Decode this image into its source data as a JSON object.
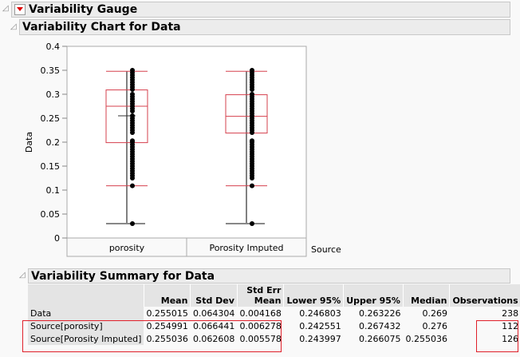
{
  "outline": {
    "gauge_title": "Variability Gauge",
    "chart_title": "Variability Chart for Data",
    "summary_title": "Variability Summary for Data"
  },
  "chart_data": {
    "type": "box",
    "ylabel": "Data",
    "xlabel": "Source",
    "ylim": [
      0,
      0.4
    ],
    "yticks": [
      "0",
      "0.05",
      "0.1",
      "0.15",
      "0.2",
      "0.25",
      "0.3",
      "0.35",
      "0.4"
    ],
    "categories": [
      "porosity",
      "Porosity Imputed"
    ],
    "boxes": [
      {
        "name": "porosity",
        "min": 0.03,
        "q1": 0.199,
        "median": 0.275,
        "q3": 0.309,
        "mean": 0.255,
        "whisker_low": 0.109,
        "whisker_high": 0.348
      },
      {
        "name": "Porosity Imputed",
        "min": 0.03,
        "q1": 0.219,
        "median": 0.254,
        "q3": 0.299,
        "mean": 0.255,
        "whisker_low": 0.109,
        "whisker_high": 0.348
      }
    ],
    "points": [
      [
        0.03,
        0.109,
        0.125,
        0.13,
        0.135,
        0.14,
        0.145,
        0.15,
        0.155,
        0.16,
        0.165,
        0.17,
        0.175,
        0.18,
        0.185,
        0.19,
        0.195,
        0.2,
        0.203,
        0.22,
        0.225,
        0.23,
        0.235,
        0.24,
        0.245,
        0.25,
        0.255,
        0.265,
        0.27,
        0.275,
        0.28,
        0.285,
        0.29,
        0.295,
        0.3,
        0.31,
        0.315,
        0.32,
        0.325,
        0.33,
        0.335,
        0.34,
        0.345,
        0.35
      ],
      [
        0.03,
        0.109,
        0.125,
        0.13,
        0.135,
        0.14,
        0.145,
        0.15,
        0.155,
        0.16,
        0.165,
        0.17,
        0.175,
        0.18,
        0.185,
        0.19,
        0.195,
        0.2,
        0.203,
        0.22,
        0.225,
        0.23,
        0.235,
        0.24,
        0.245,
        0.25,
        0.255,
        0.26,
        0.265,
        0.27,
        0.275,
        0.28,
        0.285,
        0.29,
        0.295,
        0.3,
        0.31,
        0.315,
        0.32,
        0.325,
        0.33,
        0.335,
        0.34,
        0.345,
        0.35
      ]
    ]
  },
  "summary": {
    "headers": [
      "",
      "Mean",
      "Std Dev",
      "Std Err Mean",
      "Lower 95%",
      "Upper 95%",
      "Median",
      "Observations"
    ],
    "header_err_top": "Std Err",
    "header_err_bottom": "Mean",
    "rows": [
      [
        "Data",
        "0.255015",
        "0.064304",
        "0.004168",
        "0.246803",
        "0.263226",
        "0.269",
        "238"
      ],
      [
        "Source[porosity]",
        "0.254991",
        "0.066441",
        "0.006278",
        "0.242551",
        "0.267432",
        "0.276",
        "112"
      ],
      [
        "Source[Porosity Imputed]",
        "0.255036",
        "0.062608",
        "0.005578",
        "0.243997",
        "0.266075",
        "0.255036",
        "126"
      ]
    ]
  },
  "colors": {
    "box": "#d6404e",
    "points": "#000000"
  }
}
